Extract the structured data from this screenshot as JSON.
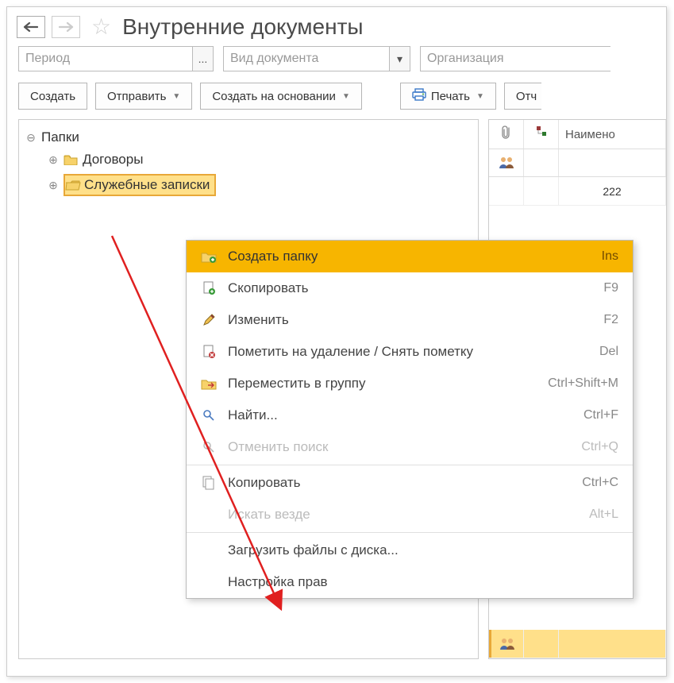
{
  "header": {
    "title": "Внутренние документы"
  },
  "filters": {
    "period_placeholder": "Период",
    "period_btn": "...",
    "doctype_placeholder": "Вид документа",
    "org_placeholder": "Организация"
  },
  "toolbar": {
    "create": "Создать",
    "send": "Отправить",
    "create_based": "Создать на основании",
    "print": "Печать",
    "report": "Отч"
  },
  "tree": {
    "root": "Папки",
    "contracts": "Договоры",
    "memos": "Служебные записки"
  },
  "list": {
    "col3": "Наимено",
    "row1": "222"
  },
  "menu": {
    "create_folder": {
      "label": "Создать папку",
      "shortcut": "Ins"
    },
    "copy_obj": {
      "label": "Скопировать",
      "shortcut": "F9"
    },
    "edit": {
      "label": "Изменить",
      "shortcut": "F2"
    },
    "delete_mark": {
      "label": "Пометить на удаление / Снять пометку",
      "shortcut": "Del"
    },
    "move_group": {
      "label": "Переместить в группу",
      "shortcut": "Ctrl+Shift+M"
    },
    "find": {
      "label": "Найти...",
      "shortcut": "Ctrl+F"
    },
    "cancel_find": {
      "label": "Отменить поиск",
      "shortcut": "Ctrl+Q"
    },
    "copy_clip": {
      "label": "Копировать",
      "shortcut": "Ctrl+C"
    },
    "search_all": {
      "label": "Искать везде",
      "shortcut": "Alt+L"
    },
    "upload": {
      "label": "Загрузить файлы с диска..."
    },
    "rights": {
      "label": "Настройка прав"
    }
  }
}
